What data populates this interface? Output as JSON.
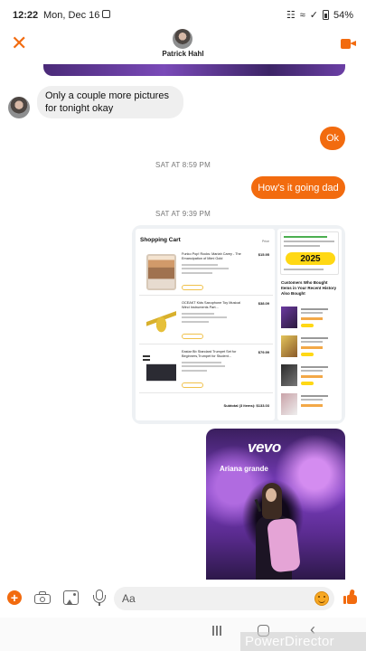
{
  "status_bar": {
    "time": "12:22",
    "date": "Mon, Dec 16",
    "battery": "54%"
  },
  "header": {
    "contact_name": "Patrick Hahl"
  },
  "messages": {
    "incoming_1": "Only a couple more pictures for tonight okay",
    "outgoing_1": "Ok",
    "timestamp_1": "SAT AT 8:59 PM",
    "outgoing_2": "How's it going dad",
    "timestamp_2": "SAT AT 9:39 PM"
  },
  "shared_screenshot": {
    "cart_title": "Shopping Cart",
    "cart_column_header": "Price",
    "items": [
      {
        "name": "Funko Pop! Rocks: Mariah Carey - The Emancipation of Mimi Gold",
        "price": "$15.95"
      },
      {
        "name": "OCEAKT Kids Saxophone Toy Musical Wind Instruments Part...",
        "price": "$38.09"
      },
      {
        "name": "Eastar Bb Standard Trumpet Set for Beginners,Trumpet for Student...",
        "price": "$79.99"
      }
    ],
    "subtotal": "Subtotal (3 items): $133.03",
    "promo_year": "2025",
    "recommend_title": "Customers Who Bought Items in Your Recent History Also Bought"
  },
  "media_card": {
    "brand": "vevo",
    "artist": "Ariana grande"
  },
  "composer": {
    "placeholder": "Aa"
  },
  "watermark": "PowerDirector",
  "colors": {
    "accent": "#f26b0f",
    "incoming_bubble": "#efefef"
  },
  "icons": {
    "header_left": "close-icon",
    "header_right": "video-call-icon",
    "composer": [
      "plus-icon",
      "camera-icon",
      "gallery-icon",
      "microphone-icon",
      "emoji-icon",
      "like-icon"
    ],
    "nav": [
      "recents-icon",
      "home-icon",
      "back-icon"
    ]
  }
}
